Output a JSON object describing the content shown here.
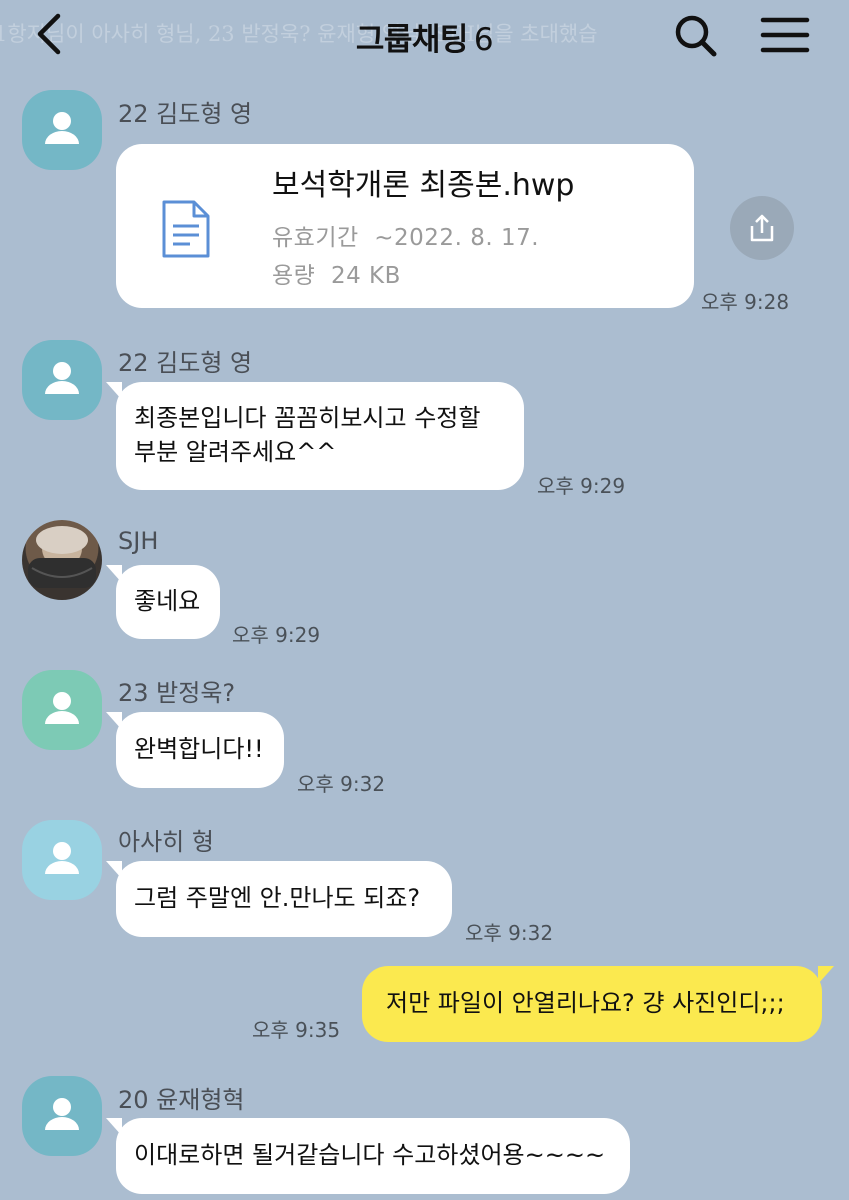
{
  "header": {
    "title": "그룹채팅",
    "member_count": "6",
    "ghost_text": "1항지님이 아사히 형님, 23 받정욱? 윤재형 영님, SJH님을 초대했습"
  },
  "messages": [
    {
      "sender": "22 김도형 영",
      "type": "file",
      "file_name": "보석학개론 최종본.hwp",
      "expiry_label": "유효기간",
      "expiry_value": "~2022. 8. 17.",
      "size_label": "용량",
      "size_value": "24 KB",
      "time": "오후 9:28"
    },
    {
      "sender": "22 김도형 영",
      "type": "text",
      "lines": [
        "최종본입니다 꼼꼼히보시고 수정할",
        "부분 알려주세요^^"
      ],
      "time": "오후 9:29"
    },
    {
      "sender": "SJH",
      "type": "text",
      "lines": [
        "좋네요"
      ],
      "time": "오후 9:29"
    },
    {
      "sender": "23 받정욱?",
      "type": "text",
      "lines": [
        "완벽합니다!!"
      ],
      "time": "오후 9:32"
    },
    {
      "sender": "아사히 형",
      "type": "text",
      "lines": [
        "그럼 주말엔 안.만나도 되죠?"
      ],
      "time": "오후 9:32"
    },
    {
      "sender": "me",
      "type": "text",
      "lines": [
        "저만 파일이 안열리나요? 걍 사진인디;;;"
      ],
      "time": "오후 9:35"
    },
    {
      "sender": "20 윤재형혁",
      "type": "text",
      "lines": [
        "이대로하면 될거같습니다 수고하셨어용~~~~"
      ]
    }
  ],
  "icons": {
    "back": "chevron-left-icon",
    "search": "search-icon",
    "menu": "hamburger-menu-icon",
    "share": "share-upload-icon",
    "file": "document-icon",
    "avatar_default": "person-icon"
  },
  "colors": {
    "background": "#abbdd0",
    "my_bubble": "#fbe94f",
    "other_bubble": "#ffffff",
    "file_icon": "#5b8fd6"
  }
}
